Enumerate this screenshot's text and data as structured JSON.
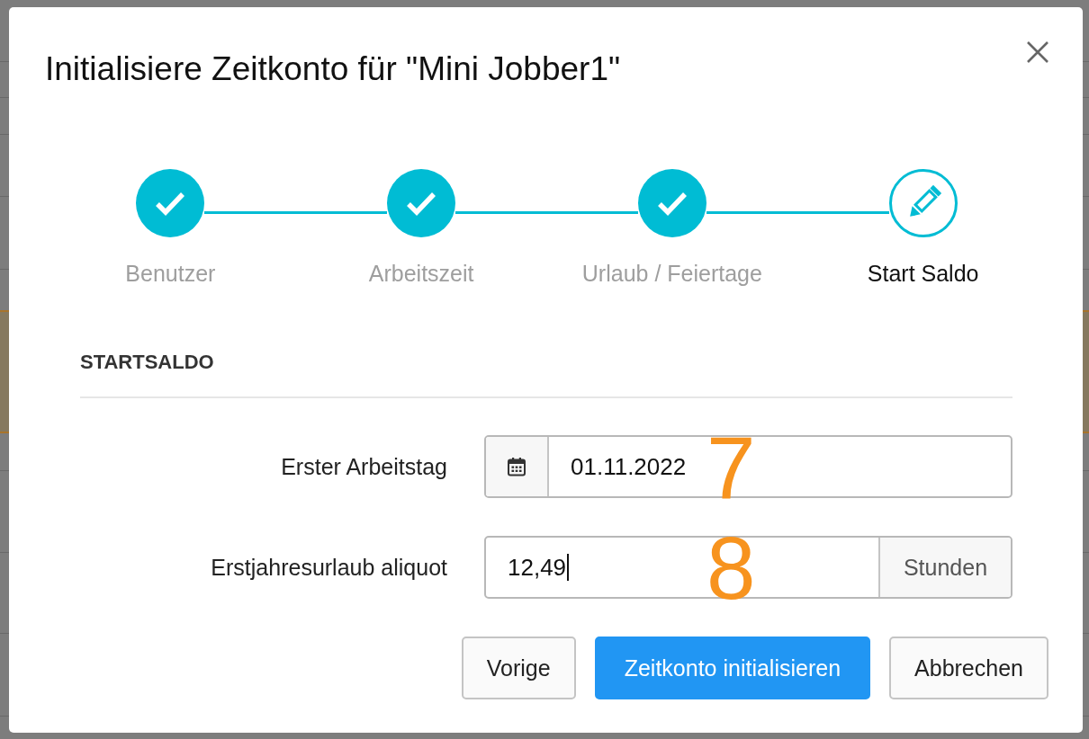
{
  "dialog": {
    "title": "Initialisiere Zeitkonto für \"Mini Jobber1\""
  },
  "steps": [
    {
      "label": "Benutzer",
      "completed": true
    },
    {
      "label": "Arbeitszeit",
      "completed": true
    },
    {
      "label": "Urlaub / Feiertage",
      "completed": true
    },
    {
      "label": "Start Saldo",
      "completed": false
    }
  ],
  "section": {
    "heading": "STARTSALDO"
  },
  "fields": [
    {
      "kind": "date",
      "label": "Erster Arbeitstag",
      "value": "01.11.2022",
      "focused": false,
      "annotation": "7"
    },
    {
      "kind": "number",
      "label": "Erstjahresurlaub aliquot",
      "value": "12,49",
      "unit": "Stunden",
      "focused": true,
      "annotation": "8"
    }
  ],
  "buttons": [
    {
      "label": "Vorige",
      "kind": "default"
    },
    {
      "label": "Zeitkonto initialisieren",
      "kind": "primary"
    },
    {
      "label": "Abbrechen",
      "kind": "default"
    }
  ]
}
